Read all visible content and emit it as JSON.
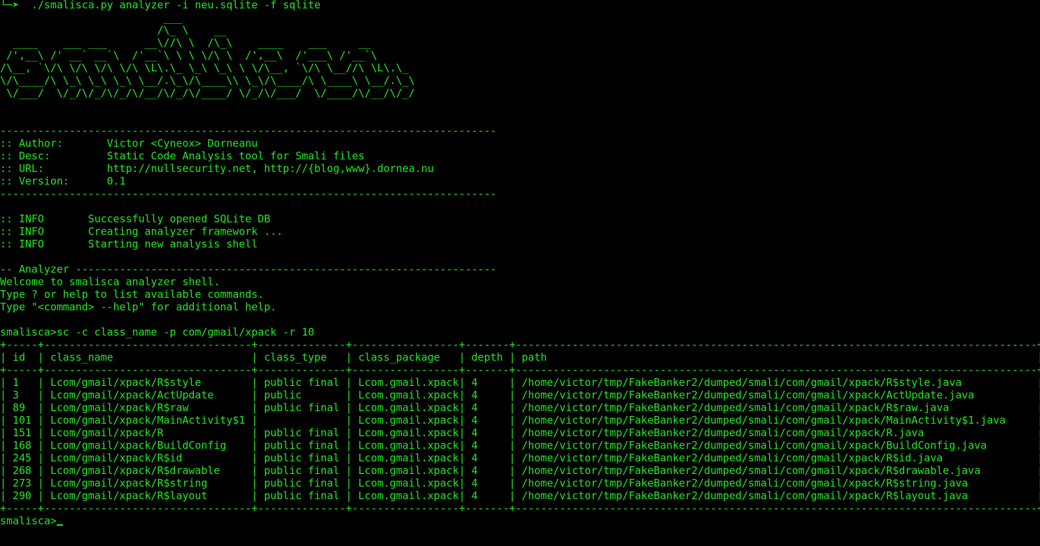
{
  "colors": {
    "background": "#000000",
    "foreground": "#22e822"
  },
  "command_line": "└─➤  ./smalisca.py analyzer -i neu.sqlite -f sqlite",
  "banner_lines": [
    "                          ___",
    "                         /\\_ \\    __",
    "  ____    ___ ___      __\\//\\ \\  /\\_\\    ____    ___     __",
    " /',__\\ /' __` __`\\  /'__`\\ \\ \\ \\/\\ \\  /',__\\  /'___\\ /'__`\\",
    "/\\__, `\\/\\ \\/\\ \\/\\ \\/\\ \\L\\.\\_ \\_\\ \\_\\ \\ \\/\\__, `\\/\\ \\__//\\ \\L\\.\\_",
    "\\/\\____/\\ \\_\\ \\_\\ \\_\\ \\__/.\\_\\/\\____\\\\ \\_\\/\\____/\\ \\____\\ \\__/.\\_\\",
    " \\/___/  \\/_/\\/_/\\/_/\\/__/\\/_/\\/____/ \\/_/\\/___/  \\/____/\\/__/\\/_/"
  ],
  "separator": "-------------------------------------------------------------------------------",
  "info": [
    {
      "key": ":: Author:",
      "value": "Victor <Cyneox> Dorneanu"
    },
    {
      "key": ":: Desc:",
      "value": "Static Code Analysis tool for Smali files"
    },
    {
      "key": ":: URL:",
      "value": "http://nullsecurity.net, http://{blog,www}.dornea.nu"
    },
    {
      "key": ":: Version:",
      "value": "0.1"
    }
  ],
  "log_lines": [
    {
      "level": ":: INFO",
      "message": "Successfully opened SQLite DB"
    },
    {
      "level": ":: INFO",
      "message": "Creating analyzer framework ..."
    },
    {
      "level": ":: INFO",
      "message": "Starting new analysis shell"
    }
  ],
  "analyzer_header": "-- Analyzer -------------------------------------------------------------------",
  "welcome_lines": [
    "Welcome to smalisca analyzer shell.",
    "Type ? or help to list available commands.",
    "Type \"<command> --help\" for additional help."
  ],
  "prompt": "smalisca>",
  "last_command": "sc -c class_name -p com/gmail/xpack -r 10",
  "table": {
    "border": "+-----+---------------------------------+--------------+-----------------+-------+-----------------------------------------------------------------------------------+",
    "columns": [
      "id",
      "class_name",
      "class_type",
      "class_package",
      "depth",
      "path"
    ],
    "rows": [
      [
        "1",
        "Lcom/gmail/xpack/R$style",
        "public final",
        "Lcom.gmail.xpack",
        "4",
        "/home/victor/tmp/FakeBanker2/dumped/smali/com/gmail/xpack/R$style.java"
      ],
      [
        "3",
        "Lcom/gmail/xpack/ActUpdate",
        "public",
        "Lcom.gmail.xpack",
        "4",
        "/home/victor/tmp/FakeBanker2/dumped/smali/com/gmail/xpack/ActUpdate.java"
      ],
      [
        "89",
        "Lcom/gmail/xpack/R$raw",
        "public final",
        "Lcom.gmail.xpack",
        "4",
        "/home/victor/tmp/FakeBanker2/dumped/smali/com/gmail/xpack/R$raw.java"
      ],
      [
        "101",
        "Lcom/gmail/xpack/MainActivity$1",
        "",
        "Lcom.gmail.xpack",
        "4",
        "/home/victor/tmp/FakeBanker2/dumped/smali/com/gmail/xpack/MainActivity$1.java"
      ],
      [
        "151",
        "Lcom/gmail/xpack/R",
        "public final",
        "Lcom.gmail.xpack",
        "4",
        "/home/victor/tmp/FakeBanker2/dumped/smali/com/gmail/xpack/R.java"
      ],
      [
        "168",
        "Lcom/gmail/xpack/BuildConfig",
        "public final",
        "Lcom.gmail.xpack",
        "4",
        "/home/victor/tmp/FakeBanker2/dumped/smali/com/gmail/xpack/BuildConfig.java"
      ],
      [
        "245",
        "Lcom/gmail/xpack/R$id",
        "public final",
        "Lcom.gmail.xpack",
        "4",
        "/home/victor/tmp/FakeBanker2/dumped/smali/com/gmail/xpack/R$id.java"
      ],
      [
        "268",
        "Lcom/gmail/xpack/R$drawable",
        "public final",
        "Lcom.gmail.xpack",
        "4",
        "/home/victor/tmp/FakeBanker2/dumped/smali/com/gmail/xpack/R$drawable.java"
      ],
      [
        "273",
        "Lcom/gmail/xpack/R$string",
        "public final",
        "Lcom.gmail.xpack",
        "4",
        "/home/victor/tmp/FakeBanker2/dumped/smali/com/gmail/xpack/R$string.java"
      ],
      [
        "290",
        "Lcom/gmail/xpack/R$layout",
        "public final",
        "Lcom.gmail.xpack",
        "4",
        "/home/victor/tmp/FakeBanker2/dumped/smali/com/gmail/xpack/R$layout.java"
      ]
    ]
  },
  "final_prompt": "smalisca>"
}
